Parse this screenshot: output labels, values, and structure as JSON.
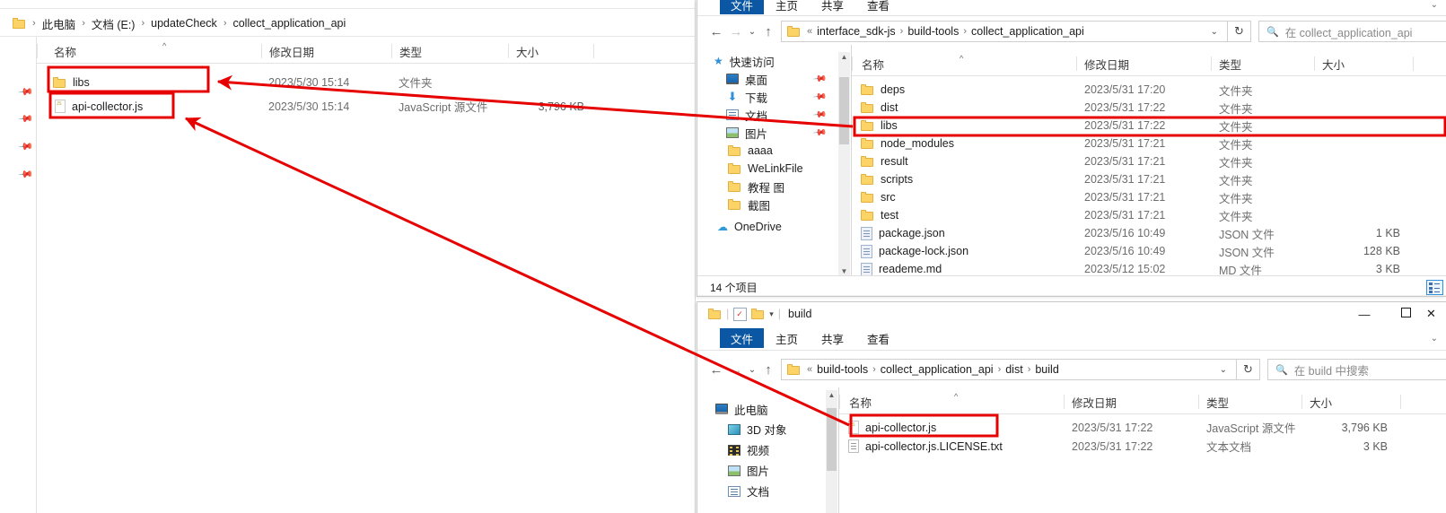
{
  "annotation": {
    "color": "#e60000",
    "box_stroke": 3,
    "arrow_stroke": 3
  },
  "left_window": {
    "name": "explorer-window-collect-application-api",
    "breadcrumb": {
      "icon": "folder-icon",
      "crumbs": [
        "此电脑",
        "文档 (E:)",
        "updateCheck",
        "collect_application_api"
      ],
      "separator": "›"
    },
    "columns": [
      "名称",
      "修改日期",
      "类型",
      "大小"
    ],
    "sort_caret": "^",
    "rows": [
      {
        "icon": "folder-icon",
        "name": "libs",
        "date": "2023/5/30 15:14",
        "type": "文件夹",
        "size": "",
        "highlighted": true
      },
      {
        "icon": "js-file-icon",
        "name": "api-collector.js",
        "date": "2023/5/30 15:14",
        "type": "JavaScript 源文件",
        "size": "3,796 KB",
        "highlighted": true
      }
    ],
    "sidebar_pins": [
      "pin-icon",
      "pin-icon",
      "pin-icon",
      "pin-icon"
    ]
  },
  "top_right_window": {
    "name": "explorer-window-collect-application-api-sdk",
    "ribbon_tabs": [
      "文件",
      "主页",
      "共享",
      "查看"
    ],
    "ribbon_active": "文件",
    "nav": {
      "back": "←",
      "forward": "→",
      "recent": "⌄",
      "up": "↑"
    },
    "address": {
      "icon": "folder-icon",
      "prefix": "«",
      "crumbs": [
        "interface_sdk-js",
        "build-tools",
        "collect_application_api"
      ],
      "separator": "›",
      "dropdown": "⌄"
    },
    "refresh": "↻",
    "search": {
      "icon": "search-icon",
      "placeholder": "在 collect_application_api"
    },
    "sidebar": [
      {
        "icon": "star-icon",
        "label": "快速访问",
        "pin": ""
      },
      {
        "icon": "desktop-icon",
        "label": "桌面",
        "pin": "pin-icon"
      },
      {
        "icon": "download-icon",
        "label": "下载",
        "pin": "pin-icon"
      },
      {
        "icon": "documents-icon",
        "label": "文档",
        "pin": "pin-icon"
      },
      {
        "icon": "pictures-icon",
        "label": "图片",
        "pin": "pin-icon"
      },
      {
        "icon": "folder-icon",
        "label": "aaaa",
        "pin": ""
      },
      {
        "icon": "folder-icon",
        "label": "WeLinkFile",
        "pin": ""
      },
      {
        "icon": "folder-icon",
        "label": "教程 图",
        "pin": ""
      },
      {
        "icon": "folder-icon",
        "label": "截图",
        "pin": ""
      },
      {
        "icon": "onedrive-icon",
        "label": "OneDrive",
        "pin": ""
      }
    ],
    "columns": [
      "名称",
      "修改日期",
      "类型",
      "大小"
    ],
    "sort_caret": "^",
    "rows": [
      {
        "icon": "folder-icon",
        "name": "deps",
        "date": "2023/5/31 17:20",
        "type": "文件夹",
        "size": "",
        "highlighted": false
      },
      {
        "icon": "folder-icon",
        "name": "dist",
        "date": "2023/5/31 17:22",
        "type": "文件夹",
        "size": "",
        "highlighted": false
      },
      {
        "icon": "folder-icon",
        "name": "libs",
        "date": "2023/5/31 17:22",
        "type": "文件夹",
        "size": "",
        "highlighted": true
      },
      {
        "icon": "folder-icon",
        "name": "node_modules",
        "date": "2023/5/31 17:21",
        "type": "文件夹",
        "size": "",
        "highlighted": false
      },
      {
        "icon": "folder-icon",
        "name": "result",
        "date": "2023/5/31 17:21",
        "type": "文件夹",
        "size": "",
        "highlighted": false
      },
      {
        "icon": "folder-icon",
        "name": "scripts",
        "date": "2023/5/31 17:21",
        "type": "文件夹",
        "size": "",
        "highlighted": false
      },
      {
        "icon": "folder-icon",
        "name": "src",
        "date": "2023/5/31 17:21",
        "type": "文件夹",
        "size": "",
        "highlighted": false
      },
      {
        "icon": "folder-icon",
        "name": "test",
        "date": "2023/5/31 17:21",
        "type": "文件夹",
        "size": "",
        "highlighted": false
      },
      {
        "icon": "json-file-icon",
        "name": "package.json",
        "date": "2023/5/16 10:49",
        "type": "JSON 文件",
        "size": "1 KB",
        "highlighted": false
      },
      {
        "icon": "json-file-icon",
        "name": "package-lock.json",
        "date": "2023/5/16 10:49",
        "type": "JSON 文件",
        "size": "128 KB",
        "highlighted": false
      },
      {
        "icon": "json-file-icon",
        "name": "reademe.md",
        "date": "2023/5/12 15:02",
        "type": "MD 文件",
        "size": "3 KB",
        "highlighted": false
      }
    ],
    "status": {
      "count": "14 个项目",
      "view_details_icon": "details-view-icon"
    }
  },
  "bottom_right_window": {
    "name": "explorer-window-build",
    "title": "build",
    "qat": [
      "folder-icon",
      "properties-icon",
      "new-folder-icon",
      "customize-chevron-icon"
    ],
    "window_controls": {
      "minimize": "—",
      "maximize": "▢",
      "close": "✕"
    },
    "ribbon_tabs": [
      "文件",
      "主页",
      "共享",
      "查看"
    ],
    "ribbon_active": "文件",
    "ribbon_expand": "⌄",
    "nav": {
      "back": "←",
      "forward": "→",
      "recent": "⌄",
      "up": "↑"
    },
    "address": {
      "icon": "folder-icon",
      "prefix": "«",
      "crumbs": [
        "build-tools",
        "collect_application_api",
        "dist",
        "build"
      ],
      "separator": "›",
      "dropdown": "⌄"
    },
    "refresh": "↻",
    "search": {
      "icon": "search-icon",
      "placeholder": "在 build 中搜索"
    },
    "sidebar": [
      {
        "icon": "pc-icon",
        "label": "此电脑"
      },
      {
        "icon": "3d-objects-icon",
        "label": "3D 对象"
      },
      {
        "icon": "videos-icon",
        "label": "视频"
      },
      {
        "icon": "pictures-icon",
        "label": "图片"
      },
      {
        "icon": "documents-icon",
        "label": "文档"
      }
    ],
    "columns": [
      "名称",
      "修改日期",
      "类型",
      "大小"
    ],
    "sort_caret": "^",
    "rows": [
      {
        "icon": "js-file-icon",
        "name": "api-collector.js",
        "date": "2023/5/31 17:22",
        "type": "JavaScript 源文件",
        "size": "3,796 KB",
        "highlighted": true
      },
      {
        "icon": "txt-file-icon",
        "name": "api-collector.js.LICENSE.txt",
        "date": "2023/5/31 17:22",
        "type": "文本文档",
        "size": "3 KB",
        "highlighted": false
      }
    ]
  }
}
